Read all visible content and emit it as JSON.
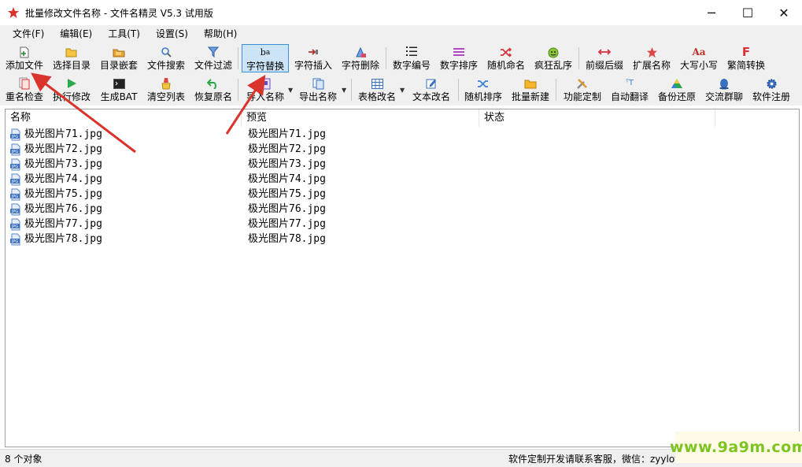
{
  "window": {
    "title": "批量修改文件名称 - 文件名精灵 V5.3 试用版",
    "controls": {
      "minimize": "─",
      "maximize": "☐",
      "close": "✕"
    }
  },
  "menu": [
    "文件(F)",
    "编辑(E)",
    "工具(T)",
    "设置(S)",
    "帮助(H)"
  ],
  "toolbar_row1": [
    {
      "label": "添加文件",
      "icon": "add-file-icon"
    },
    {
      "label": "选择目录",
      "icon": "folder-open-icon"
    },
    {
      "label": "目录嵌套",
      "icon": "folder-nest-icon"
    },
    {
      "label": "文件搜索",
      "icon": "search-icon"
    },
    {
      "label": "文件过滤",
      "icon": "filter-icon"
    },
    {
      "label": "字符替换",
      "icon": "replace-text-icon"
    },
    {
      "label": "字符插入",
      "icon": "insert-text-icon"
    },
    {
      "label": "字符删除",
      "icon": "eraser-icon"
    },
    {
      "label": "数字编号",
      "icon": "numbered-list-icon"
    },
    {
      "label": "数字排序",
      "icon": "sort-lines-icon"
    },
    {
      "label": "随机命名",
      "icon": "shuffle-icon"
    },
    {
      "label": "疯狂乱序",
      "icon": "crazy-face-icon"
    },
    {
      "label": "前缀后缀",
      "icon": "prefix-suffix-icon"
    },
    {
      "label": "扩展名称",
      "icon": "star-icon"
    },
    {
      "label": "大写小写",
      "icon": "case-icon"
    },
    {
      "label": "繁简转换",
      "icon": "convert-f-icon"
    }
  ],
  "toolbar_row2": [
    {
      "label": "重名检查",
      "icon": "duplicate-check-icon"
    },
    {
      "label": "执行修改",
      "icon": "play-icon"
    },
    {
      "label": "生成BAT",
      "icon": "terminal-icon"
    },
    {
      "label": "清空列表",
      "icon": "clear-list-icon"
    },
    {
      "label": "恢复原名",
      "icon": "undo-icon"
    },
    {
      "label": "导入名称",
      "icon": "import-icon"
    },
    {
      "label": "导出名称",
      "icon": "export-icon"
    },
    {
      "label": "表格改名",
      "icon": "grid-icon"
    },
    {
      "label": "文本改名",
      "icon": "edit-text-icon"
    },
    {
      "label": "随机排序",
      "icon": "random-sort-icon"
    },
    {
      "label": "批量新建",
      "icon": "new-folder-icon"
    },
    {
      "label": "功能定制",
      "icon": "tools-icon"
    },
    {
      "label": "自动翻译",
      "icon": "translate-icon"
    },
    {
      "label": "备份还原",
      "icon": "backup-drive-icon"
    },
    {
      "label": "交流群聊",
      "icon": "chat-icon"
    },
    {
      "label": "软件注册",
      "icon": "gear-icon"
    }
  ],
  "list": {
    "columns": [
      "名称",
      "预览",
      "状态"
    ],
    "rows": [
      {
        "name": "极光图片71.jpg",
        "preview": "极光图片71.jpg"
      },
      {
        "name": "极光图片72.jpg",
        "preview": "极光图片72.jpg"
      },
      {
        "name": "极光图片73.jpg",
        "preview": "极光图片73.jpg"
      },
      {
        "name": "极光图片74.jpg",
        "preview": "极光图片74.jpg"
      },
      {
        "name": "极光图片75.jpg",
        "preview": "极光图片75.jpg"
      },
      {
        "name": "极光图片76.jpg",
        "preview": "极光图片76.jpg"
      },
      {
        "name": "极光图片77.jpg",
        "preview": "极光图片77.jpg"
      },
      {
        "name": "极光图片78.jpg",
        "preview": "极光图片78.jpg"
      }
    ],
    "file_icon_text": "JPG"
  },
  "status": {
    "count": "8 个对象",
    "contact": "软件定制开发请联系客服，微信：zyylov"
  },
  "watermark": "www.9a9m.com",
  "colors": {
    "toolbar_bg": "#f0f0f0",
    "active_border": "#3a8fd8",
    "active_bg": "#cce4f7",
    "annotation_arrow": "#d9332b",
    "watermark": "#7cc41f"
  }
}
